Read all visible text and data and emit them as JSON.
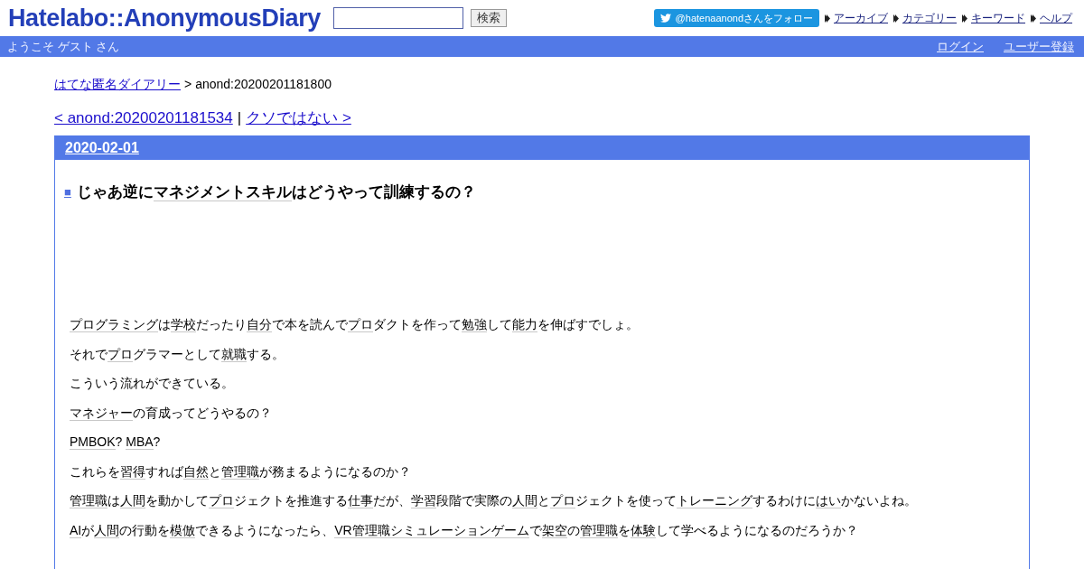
{
  "header": {
    "logo": "Hatelabo::AnonymousDiary",
    "search": {
      "button": "検索"
    },
    "follow_button": "@hatenaanondさんをフォロー",
    "nav_links": [
      "アーカイブ",
      "カテゴリー",
      "キーワード",
      "ヘルプ"
    ]
  },
  "user_bar": {
    "greeting": "ようこそ ゲスト さん",
    "links": [
      "ログイン",
      "ユーザー登録"
    ]
  },
  "breadcrumb": {
    "link": "はてな匿名ダイアリー",
    "separator": ">",
    "current": "anond:20200201181800"
  },
  "pager": {
    "prev": "< anond:20200201181534",
    "separator": "|",
    "next": "クソではない >"
  },
  "entry": {
    "date": "2020-02-01",
    "mark": "■",
    "title": [
      {
        "text": "じゃあ逆に",
        "kind": "plain"
      },
      {
        "text": "マネジメントスキル",
        "kind": "keyword"
      },
      {
        "text": "はどうやって訓練するの？",
        "kind": "plain"
      }
    ],
    "paragraphs": [
      [
        {
          "text": "プログラミング",
          "kind": "keyword"
        },
        {
          "text": "は",
          "kind": "plain"
        },
        {
          "text": "学校",
          "kind": "keyword"
        },
        {
          "text": "だったり",
          "kind": "plain"
        },
        {
          "text": "自分",
          "kind": "keyword"
        },
        {
          "text": "で本を読んで",
          "kind": "plain"
        },
        {
          "text": "プロ",
          "kind": "keyword"
        },
        {
          "text": "ダクトを作って",
          "kind": "plain"
        },
        {
          "text": "勉強",
          "kind": "keyword"
        },
        {
          "text": "して",
          "kind": "plain"
        },
        {
          "text": "能力",
          "kind": "keyword"
        },
        {
          "text": "を伸ばすでしょ。",
          "kind": "plain"
        }
      ],
      [
        {
          "text": "それで",
          "kind": "plain"
        },
        {
          "text": "プロ",
          "kind": "keyword"
        },
        {
          "text": "グラマーとして",
          "kind": "plain"
        },
        {
          "text": "就職",
          "kind": "keyword"
        },
        {
          "text": "する。",
          "kind": "plain"
        }
      ],
      [
        {
          "text": "こういう流れができている。",
          "kind": "plain"
        }
      ],
      [
        {
          "text": "マネジャー",
          "kind": "keyword"
        },
        {
          "text": "の育成ってどうやるの？",
          "kind": "plain"
        }
      ],
      [
        {
          "text": "PMBOK",
          "kind": "keyword"
        },
        {
          "text": "? ",
          "kind": "plain"
        },
        {
          "text": "MBA",
          "kind": "keyword"
        },
        {
          "text": "?",
          "kind": "plain"
        }
      ],
      [
        {
          "text": "これらを",
          "kind": "plain"
        },
        {
          "text": "習得",
          "kind": "keyword"
        },
        {
          "text": "すれば",
          "kind": "plain"
        },
        {
          "text": "自然",
          "kind": "keyword"
        },
        {
          "text": "と",
          "kind": "plain"
        },
        {
          "text": "管理職",
          "kind": "keyword"
        },
        {
          "text": "が務まるようになるのか？",
          "kind": "plain"
        }
      ],
      [
        {
          "text": "管理職",
          "kind": "keyword"
        },
        {
          "text": "は",
          "kind": "plain"
        },
        {
          "text": "人間",
          "kind": "keyword"
        },
        {
          "text": "を動かして",
          "kind": "plain"
        },
        {
          "text": "プロ",
          "kind": "keyword"
        },
        {
          "text": "ジェクトを推進する",
          "kind": "plain"
        },
        {
          "text": "仕事",
          "kind": "keyword"
        },
        {
          "text": "だが、",
          "kind": "plain"
        },
        {
          "text": "学習",
          "kind": "keyword"
        },
        {
          "text": "段階で実際の",
          "kind": "plain"
        },
        {
          "text": "人間",
          "kind": "keyword"
        },
        {
          "text": "と",
          "kind": "plain"
        },
        {
          "text": "プロ",
          "kind": "keyword"
        },
        {
          "text": "ジェクトを使って",
          "kind": "plain"
        },
        {
          "text": "トレーニング",
          "kind": "keyword"
        },
        {
          "text": "するわけに",
          "kind": "plain"
        },
        {
          "text": "はい",
          "kind": "keyword"
        },
        {
          "text": "かないよね。",
          "kind": "plain"
        }
      ],
      [
        {
          "text": "AI",
          "kind": "keyword"
        },
        {
          "text": "が",
          "kind": "plain"
        },
        {
          "text": "人間",
          "kind": "keyword"
        },
        {
          "text": "の行動を",
          "kind": "plain"
        },
        {
          "text": "模倣",
          "kind": "keyword"
        },
        {
          "text": "できるようになったら、",
          "kind": "plain"
        },
        {
          "text": "VR管理職シミュレーションゲーム",
          "kind": "keyword"
        },
        {
          "text": "で",
          "kind": "plain"
        },
        {
          "text": "架空",
          "kind": "keyword"
        },
        {
          "text": "の",
          "kind": "plain"
        },
        {
          "text": "管理職",
          "kind": "keyword"
        },
        {
          "text": "を",
          "kind": "plain"
        },
        {
          "text": "体験",
          "kind": "keyword"
        },
        {
          "text": "して学べるようになるのだろうか？",
          "kind": "plain"
        }
      ]
    ]
  }
}
